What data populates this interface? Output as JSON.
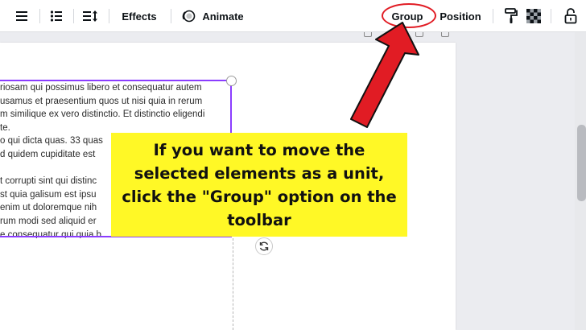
{
  "toolbar": {
    "effects_label": "Effects",
    "animate_label": "Animate",
    "group_label": "Group",
    "position_label": "Position",
    "icons": [
      "align-icon",
      "list-icon",
      "line-spacing-icon",
      "animate-icon",
      "paint-roller-icon",
      "transparency-icon",
      "lock-icon"
    ]
  },
  "text_block": {
    "lines": [
      "riosam qui possimus libero et consequatur autem",
      "usamus et praesentium quos ut nisi quia in rerum",
      "m similique ex vero distinctio. Et distinctio eligendi",
      "te.",
      "o qui dicta quas. 33 quas",
      "d quidem cupiditate est",
      "",
      "t corrupti sint qui distinc",
      "st quia galisum est ipsu",
      "enim ut doloremque nih",
      "rum modi sed aliquid er",
      "e consequatur qui quia b"
    ]
  },
  "callout": {
    "text": "If you want to move the selected elements as a unit, click the \"Group\" option on the toolbar"
  },
  "colors": {
    "selection": "#8b3dff",
    "annotation_red": "#e11c24",
    "callout_yellow": "#fff826"
  }
}
